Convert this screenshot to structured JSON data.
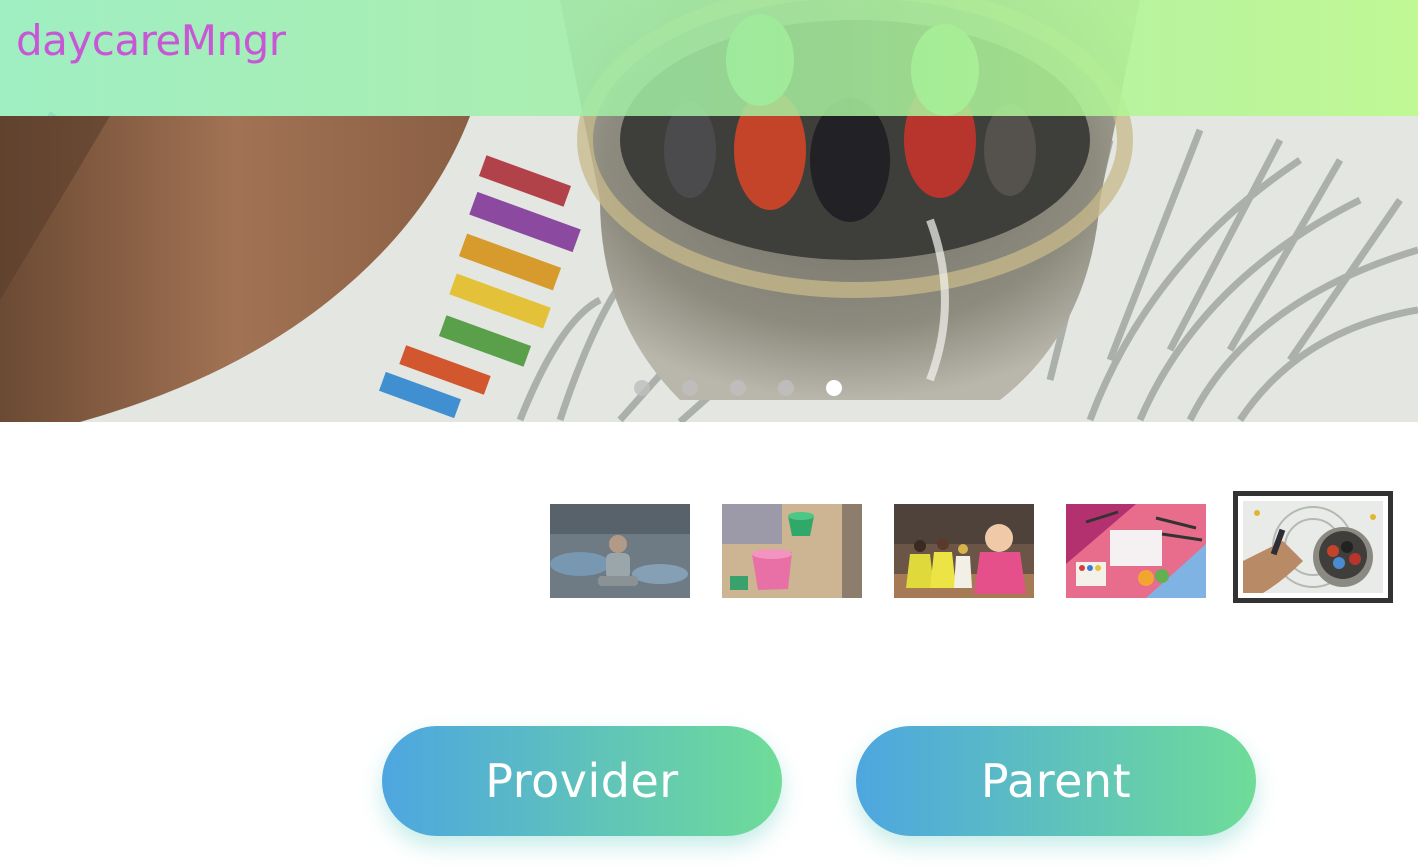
{
  "app": {
    "brand": "daycareMngr",
    "colors": {
      "brand_text": "#c857d6",
      "header_gradient_start": "#96f0be",
      "header_gradient_end": "#bcfa8c",
      "button_gradient_start": "#4ea6e0",
      "button_gradient_end": "#6fdc98"
    }
  },
  "carousel": {
    "slides_count": 5,
    "active_index": 4,
    "current_slide_image": "hand-with-crayon-jar-photo",
    "dot_labels": [
      "slide-1",
      "slide-2",
      "slide-3",
      "slide-4",
      "slide-5"
    ]
  },
  "thumbnails": [
    {
      "image": "child-sitting-painting-photo"
    },
    {
      "image": "sandbox-toys-photo"
    },
    {
      "image": "toddler-with-dolls-photo"
    },
    {
      "image": "art-supplies-flatlay-photo"
    },
    {
      "image": "hand-with-crayon-jar-photo",
      "selected": true
    }
  ],
  "actions": {
    "provider_label": "Provider",
    "parent_label": "Parent"
  }
}
